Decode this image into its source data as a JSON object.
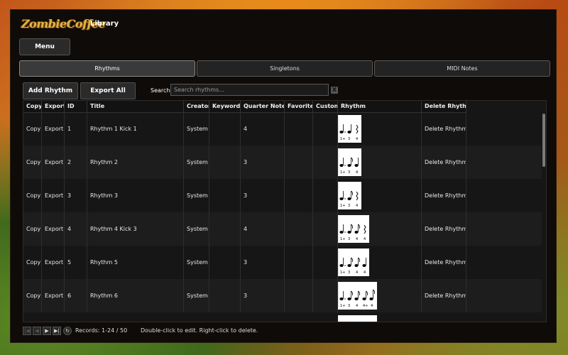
{
  "app": {
    "logo_text": "ZombieCoffee",
    "title": "Library"
  },
  "menu_label": "Menu",
  "tabs": [
    {
      "label": "Rhythms",
      "active": true
    },
    {
      "label": "Singletons",
      "active": false
    },
    {
      "label": "MIDI Notes",
      "active": false
    }
  ],
  "toolbar": {
    "add_label": "Add Rhythm",
    "export_all_label": "Export All",
    "search_label": "Search",
    "search_placeholder": "Search rhythms...",
    "clear_label": "X"
  },
  "table": {
    "columns": [
      "Copy",
      "Export",
      "ID",
      "Title",
      "Creator",
      "Keywords",
      "Quarter Notes",
      "Favorite",
      "Custom",
      "Rhythm",
      "Delete Rhythm"
    ],
    "rows": [
      {
        "copy": "Copy",
        "export": "Export",
        "id": "1",
        "title": "Rhythm 1 Kick 1",
        "creator": "System",
        "keywords": "",
        "quarter_notes": "4",
        "favorite": "",
        "custom": "",
        "rhythm_icon": "rhythm-notation-4",
        "delete": "Delete Rhythm"
      },
      {
        "copy": "Copy",
        "export": "Export",
        "id": "2",
        "title": "Rhythm 2",
        "creator": "System",
        "keywords": "",
        "quarter_notes": "3",
        "favorite": "",
        "custom": "",
        "rhythm_icon": "rhythm-notation-3",
        "delete": "Delete Rhythm"
      },
      {
        "copy": "Copy",
        "export": "Export",
        "id": "3",
        "title": "Rhythm 3",
        "creator": "System",
        "keywords": "",
        "quarter_notes": "3",
        "favorite": "",
        "custom": "",
        "rhythm_icon": "rhythm-notation-3",
        "delete": "Delete Rhythm"
      },
      {
        "copy": "Copy",
        "export": "Export",
        "id": "4",
        "title": "Rhythm 4 Kick 3",
        "creator": "System",
        "keywords": "",
        "quarter_notes": "4",
        "favorite": "",
        "custom": "",
        "rhythm_icon": "rhythm-notation-4",
        "delete": "Delete Rhythm"
      },
      {
        "copy": "Copy",
        "export": "Export",
        "id": "5",
        "title": "Rhythm 5",
        "creator": "System",
        "keywords": "",
        "quarter_notes": "3",
        "favorite": "",
        "custom": "",
        "rhythm_icon": "rhythm-notation-4",
        "delete": "Delete Rhythm"
      },
      {
        "copy": "Copy",
        "export": "Export",
        "id": "6",
        "title": "Rhythm 6",
        "creator": "System",
        "keywords": "",
        "quarter_notes": "3",
        "favorite": "",
        "custom": "",
        "rhythm_icon": "rhythm-notation-5",
        "delete": "Delete Rhythm"
      }
    ]
  },
  "footer": {
    "records": "Records: 1-24 / 50",
    "hint": "Double-click to edit. Right-click to delete."
  }
}
